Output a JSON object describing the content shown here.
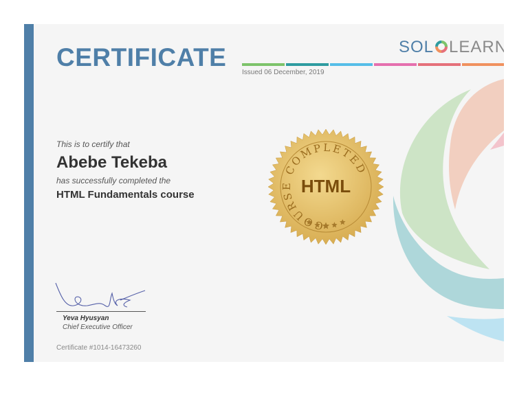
{
  "certificate": {
    "title": "CERTIFICATE",
    "brand": {
      "part1": "SOL",
      "part2": "LEARN"
    },
    "issued": "Issued 06 December, 2019",
    "certify_text": "This is to certify that",
    "recipient": "Abebe Tekeba",
    "completed_text": "has successfully completed the",
    "course": "HTML Fundamentals course",
    "seal": {
      "ring_text": "COURSE COMPLETED",
      "label": "HTML",
      "stars": 5
    },
    "signatory": {
      "name": "Yeva Hyusyan",
      "title": "Chief Executive Officer"
    },
    "number": "Certificate #1014-16473260",
    "colors": {
      "accent": "#4f7fa8",
      "stripes": [
        "#7dc36b",
        "#2e9ca0",
        "#55bde8",
        "#e56fae",
        "#e5707a",
        "#f0915e"
      ]
    }
  }
}
